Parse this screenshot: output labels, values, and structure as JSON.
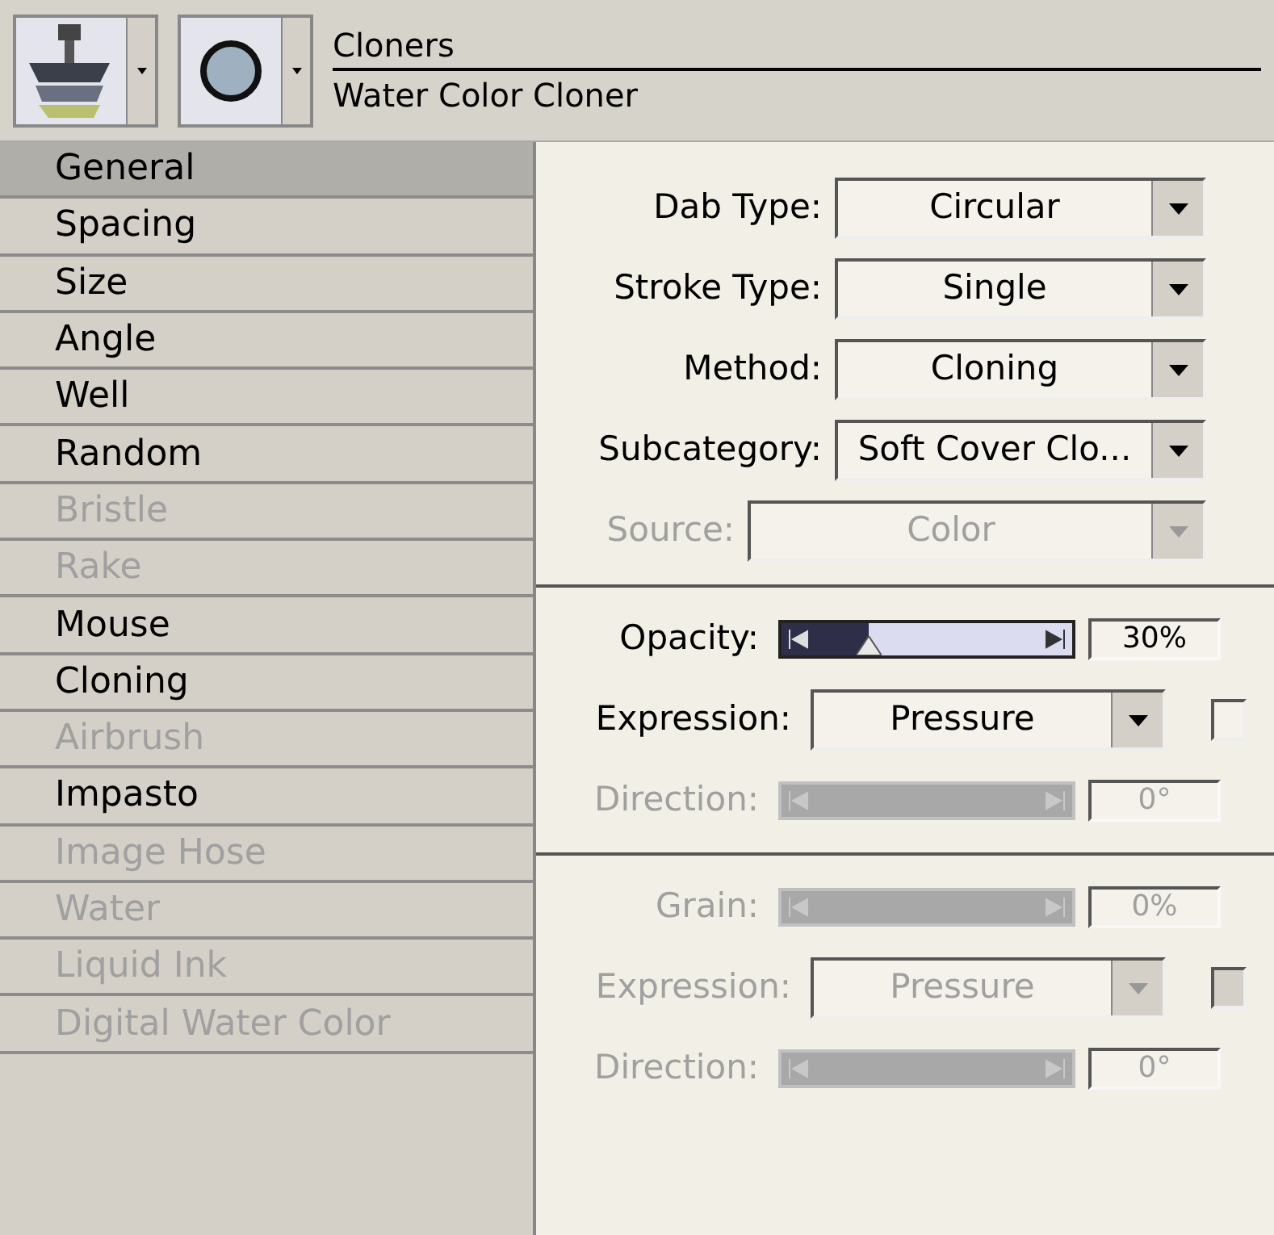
{
  "header": {
    "category": "Cloners",
    "variant": "Water Color Cloner"
  },
  "categories": [
    {
      "label": "General",
      "selected": true,
      "disabled": false
    },
    {
      "label": "Spacing",
      "selected": false,
      "disabled": false
    },
    {
      "label": "Size",
      "selected": false,
      "disabled": false
    },
    {
      "label": "Angle",
      "selected": false,
      "disabled": false
    },
    {
      "label": "Well",
      "selected": false,
      "disabled": false
    },
    {
      "label": "Random",
      "selected": false,
      "disabled": false
    },
    {
      "label": "Bristle",
      "selected": false,
      "disabled": true
    },
    {
      "label": "Rake",
      "selected": false,
      "disabled": true
    },
    {
      "label": "Mouse",
      "selected": false,
      "disabled": false
    },
    {
      "label": "Cloning",
      "selected": false,
      "disabled": false
    },
    {
      "label": "Airbrush",
      "selected": false,
      "disabled": true
    },
    {
      "label": "Impasto",
      "selected": false,
      "disabled": false
    },
    {
      "label": "Image Hose",
      "selected": false,
      "disabled": true
    },
    {
      "label": "Water",
      "selected": false,
      "disabled": true
    },
    {
      "label": "Liquid Ink",
      "selected": false,
      "disabled": true
    },
    {
      "label": "Digital Water Color",
      "selected": false,
      "disabled": true
    }
  ],
  "sections": [
    [
      {
        "kind": "dropdown",
        "label": "Dab Type:",
        "value": "Circular",
        "disabled": false
      },
      {
        "kind": "dropdown",
        "label": "Stroke Type:",
        "value": "Single",
        "disabled": false
      },
      {
        "kind": "dropdown",
        "label": "Method:",
        "value": "Cloning",
        "disabled": false
      },
      {
        "kind": "dropdown",
        "label": "Subcategory:",
        "value": "Soft Cover Clo...",
        "disabled": false
      },
      {
        "kind": "dropdown",
        "label": "Source:",
        "value": "Color",
        "disabled": true
      }
    ],
    [
      {
        "kind": "slider",
        "label": "Opacity:",
        "level": 0.3,
        "reading": "30%",
        "disabled": false
      },
      {
        "kind": "expression",
        "label": "Expression:",
        "value": "Pressure",
        "checked": false,
        "disabled": false
      },
      {
        "kind": "slider",
        "label": "Direction:",
        "reading": "0°",
        "disabled": true
      }
    ],
    [
      {
        "kind": "slider",
        "label": "Grain:",
        "reading": "0%",
        "disabled": true
      },
      {
        "kind": "expression",
        "label": "Expression:",
        "value": "Pressure",
        "checked": false,
        "disabled": true
      },
      {
        "kind": "slider",
        "label": "Direction:",
        "reading": "0°",
        "disabled": true
      }
    ]
  ]
}
